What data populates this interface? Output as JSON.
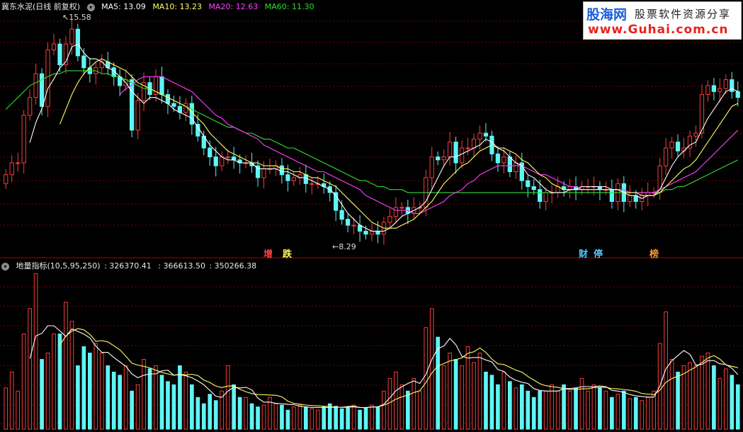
{
  "header": {
    "stock_name": "冀东水泥(日线 前复权)",
    "ma5": "MA5: 13.09",
    "ma10": "MA10: 13.23",
    "ma20": "MA20: 12.63",
    "ma60": "MA60: 11.30"
  },
  "indicator_header": {
    "name": "地量指标(10,5,95,250)",
    "v1": ": 326370.41",
    "v2": ": 366613.50",
    "v3": ": 350266.38"
  },
  "watermark": {
    "brand": "股海网",
    "slogan": "股票软件资源分享",
    "url": "www.Guhai.com.cn"
  },
  "events": [
    {
      "label": "增",
      "color": "#ff4040"
    },
    {
      "label": "跌",
      "color": "#ffff55"
    },
    {
      "label": "财",
      "color": "#55c8ff"
    },
    {
      "label": "停",
      "color": "#55c8ff"
    },
    {
      "label": "榜",
      "color": "#ff9a30"
    }
  ],
  "colors": {
    "up": "#ff3b3b",
    "down": "#5ff5f5",
    "ma5": "#ffffff",
    "ma10": "#ffff66",
    "ma20": "#ff40ff",
    "ma60": "#33dd33",
    "grid": "#7a0000",
    "separator": "#b00000"
  },
  "chart_data": [
    {
      "type": "candlestick",
      "title": "冀东水泥(日线 前复权)",
      "max_label": "15.58",
      "min_label": "8.29",
      "ylim": [
        7.8,
        16.0
      ],
      "series_names": [
        "MA5",
        "MA10",
        "MA20",
        "MA60"
      ],
      "close": [
        10.5,
        10.9,
        10.9,
        12.5,
        13.1,
        13.9,
        12.8,
        14.7,
        14.9,
        14.2,
        14.9,
        15.4,
        14.5,
        14.1,
        13.9,
        14.1,
        14.3,
        14.1,
        13.8,
        13.5,
        13.7,
        12.0,
        13.0,
        13.6,
        13.2,
        13.8,
        13.2,
        12.9,
        12.8,
        12.6,
        12.9,
        12.2,
        11.8,
        11.4,
        11.1,
        10.8,
        11.1,
        11.1,
        11.0,
        10.9,
        10.9,
        10.8,
        10.4,
        10.7,
        10.7,
        10.8,
        10.5,
        10.3,
        10.4,
        10.5,
        10.2,
        10.2,
        10.2,
        10.1,
        9.9,
        9.3,
        9.0,
        8.8,
        8.8,
        8.6,
        8.5,
        8.6,
        8.5,
        8.9,
        9.1,
        9.4,
        9.4,
        9.2,
        9.4,
        9.4,
        10.4,
        11.1,
        11.0,
        11.1,
        11.6,
        10.9,
        11.4,
        11.4,
        11.7,
        11.9,
        11.8,
        11.2,
        10.9,
        11.1,
        10.6,
        10.9,
        10.3,
        10.1,
        10.0,
        9.6,
        9.9,
        9.9,
        10.1,
        10.0,
        10.1,
        10.0,
        10.1,
        10.1,
        10.1,
        10.0,
        10.0,
        9.6,
        10.2,
        9.6,
        9.8,
        9.6,
        9.8,
        9.9,
        9.9,
        10.8,
        11.4,
        11.6,
        11.3,
        11.4,
        11.8,
        11.9,
        13.2,
        13.5,
        13.3,
        13.4,
        13.7,
        13.3,
        13.1
      ],
      "ma5": [
        null,
        null,
        null,
        null,
        11.58,
        12.26,
        12.72,
        13.4,
        13.72,
        14.1,
        14.3,
        14.8,
        14.9,
        14.6,
        14.4,
        14.4,
        14.3,
        14.1,
        14.0,
        13.8,
        13.6,
        13.3,
        13.1,
        12.9,
        13.1,
        13.1,
        13.0,
        12.9,
        12.7,
        12.6,
        12.5,
        12.4,
        12.1,
        11.8,
        11.5,
        11.3,
        11.1,
        11.0,
        11.0,
        10.9,
        10.9,
        10.9,
        10.7,
        10.7,
        10.7,
        10.7,
        10.6,
        10.6,
        10.5,
        10.4,
        10.4,
        10.3,
        10.2,
        10.1,
        10.0,
        9.8,
        9.5,
        9.2,
        9.0,
        8.8,
        8.7,
        8.6,
        8.6,
        8.6,
        8.7,
        8.9,
        9.1,
        9.2,
        9.3,
        9.4,
        9.6,
        10.0,
        10.4,
        10.8,
        11.1,
        11.1,
        11.2,
        11.3,
        11.4,
        11.5,
        11.7,
        11.6,
        11.4,
        11.3,
        11.1,
        10.9,
        10.8,
        10.5,
        10.4,
        10.2,
        10.0,
        9.9,
        9.9,
        9.9,
        10.0,
        10.0,
        10.1,
        10.1,
        10.1,
        10.1,
        10.1,
        10.0,
        10.0,
        9.9,
        9.8,
        9.8,
        9.7,
        9.8,
        9.8,
        10.0,
        10.4,
        10.8,
        11.1,
        11.3,
        11.5,
        11.6,
        12.0,
        12.4,
        12.7,
        13.0,
        13.3,
        13.4,
        13.3
      ],
      "ma10": [
        null,
        null,
        null,
        null,
        null,
        null,
        null,
        null,
        null,
        12.2,
        12.7,
        13.2,
        13.6,
        13.9,
        14.1,
        14.3,
        14.4,
        14.3,
        14.2,
        14.1,
        14.0,
        13.8,
        13.6,
        13.5,
        13.4,
        13.3,
        13.2,
        13.1,
        13.0,
        12.9,
        12.8,
        12.6,
        12.4,
        12.2,
        11.9,
        11.7,
        11.5,
        11.3,
        11.2,
        11.1,
        11.0,
        10.9,
        10.9,
        10.8,
        10.8,
        10.8,
        10.7,
        10.7,
        10.6,
        10.6,
        10.5,
        10.4,
        10.4,
        10.3,
        10.2,
        10.1,
        9.9,
        9.7,
        9.5,
        9.3,
        9.1,
        8.9,
        8.8,
        8.7,
        8.7,
        8.7,
        8.8,
        8.9,
        9.0,
        9.2,
        9.4,
        9.6,
        9.9,
        10.2,
        10.4,
        10.6,
        10.8,
        10.9,
        11.1,
        11.3,
        11.4,
        11.5,
        11.4,
        11.4,
        11.3,
        11.2,
        11.0,
        10.9,
        10.7,
        10.5,
        10.4,
        10.2,
        10.1,
        10.0,
        10.0,
        10.0,
        10.0,
        10.0,
        10.0,
        10.0,
        10.0,
        10.0,
        10.0,
        9.9,
        9.9,
        9.9,
        9.8,
        9.8,
        9.8,
        9.9,
        10.1,
        10.3,
        10.5,
        10.7,
        10.8,
        11.0,
        11.3,
        11.6,
        11.9,
        12.2,
        12.5,
        12.8,
        12.9
      ],
      "ma20": [
        null,
        null,
        null,
        null,
        null,
        null,
        null,
        null,
        null,
        null,
        null,
        null,
        null,
        null,
        null,
        null,
        null,
        null,
        null,
        13.2,
        13.4,
        13.5,
        13.7,
        13.8,
        13.8,
        13.8,
        13.8,
        13.7,
        13.6,
        13.5,
        13.4,
        13.3,
        13.1,
        12.9,
        12.7,
        12.5,
        12.4,
        12.2,
        12.1,
        12.0,
        11.9,
        11.8,
        11.7,
        11.5,
        11.4,
        11.3,
        11.2,
        11.1,
        11.0,
        10.9,
        10.8,
        10.7,
        10.6,
        10.6,
        10.5,
        10.4,
        10.3,
        10.2,
        10.1,
        10.0,
        9.8,
        9.7,
        9.6,
        9.5,
        9.4,
        9.3,
        9.3,
        9.3,
        9.2,
        9.2,
        9.3,
        9.4,
        9.5,
        9.6,
        9.8,
        9.9,
        10.0,
        10.2,
        10.3,
        10.5,
        10.6,
        10.7,
        10.8,
        10.8,
        10.8,
        10.8,
        10.8,
        10.7,
        10.6,
        10.5,
        10.5,
        10.4,
        10.3,
        10.2,
        10.1,
        10.1,
        10.0,
        10.0,
        10.0,
        10.0,
        10.0,
        10.0,
        10.0,
        10.0,
        9.9,
        9.9,
        9.9,
        9.9,
        9.9,
        10.0,
        10.1,
        10.2,
        10.3,
        10.4,
        10.5,
        10.6,
        10.8,
        11.0,
        11.2,
        11.4,
        11.6,
        11.8,
        12.0
      ],
      "ma60": [
        12.7,
        12.9,
        13.1,
        13.3,
        13.5,
        13.6,
        13.7,
        13.8,
        13.9,
        13.9,
        14.0,
        14.0,
        14.0,
        14.0,
        14.0,
        14.0,
        13.9,
        13.9,
        13.8,
        13.8,
        13.7,
        13.6,
        13.5,
        13.4,
        13.4,
        13.3,
        13.2,
        13.1,
        13.0,
        12.9,
        12.8,
        12.7,
        12.6,
        12.5,
        12.4,
        12.3,
        12.2,
        12.1,
        12.1,
        12.0,
        11.9,
        11.9,
        11.8,
        11.7,
        11.7,
        11.6,
        11.5,
        11.4,
        11.4,
        11.3,
        11.2,
        11.1,
        11.0,
        10.9,
        10.8,
        10.7,
        10.6,
        10.5,
        10.4,
        10.3,
        10.3,
        10.2,
        10.1,
        10.1,
        10.0,
        10.0,
        10.0,
        9.9,
        9.9,
        9.9,
        9.9,
        9.9,
        9.9,
        9.9,
        9.9,
        9.9,
        9.9,
        9.9,
        9.9,
        9.9,
        9.9,
        9.9,
        9.9,
        9.9,
        9.9,
        9.9,
        9.9,
        9.9,
        9.9,
        9.9,
        9.9,
        9.9,
        9.9,
        9.9,
        9.9,
        9.9,
        9.9,
        9.9,
        9.9,
        9.9,
        9.9,
        9.9,
        9.9,
        9.9,
        9.9,
        9.9,
        9.9,
        9.9,
        9.9,
        9.9,
        10.0,
        10.0,
        10.1,
        10.1,
        10.2,
        10.3,
        10.4,
        10.5,
        10.6,
        10.7,
        10.8,
        10.9,
        11.0
      ]
    },
    {
      "type": "bar",
      "title": "地量指标(10,5,95,250)",
      "ylim": [
        0,
        2500000
      ],
      "volume": [
        650000,
        900000,
        600000,
        1500000,
        1900000,
        2450000,
        1100000,
        1200000,
        1500000,
        1500000,
        2000000,
        1700000,
        1000000,
        1300000,
        1200000,
        1350000,
        1200000,
        1000000,
        900000,
        850000,
        1000000,
        600000,
        700000,
        1100000,
        950000,
        1000000,
        850000,
        750000,
        700000,
        1000000,
        900000,
        700000,
        500000,
        400000,
        550000,
        450000,
        600000,
        1000000,
        700000,
        500000,
        500000,
        400000,
        350000,
        380000,
        500000,
        400000,
        380000,
        300000,
        350000,
        380000,
        350000,
        320000,
        300000,
        350000,
        400000,
        360000,
        320000,
        350000,
        380000,
        300000,
        340000,
        380000,
        350000,
        600000,
        800000,
        900000,
        700000,
        600000,
        800000,
        600000,
        1600000,
        1900000,
        1450000,
        1000000,
        1200000,
        1100000,
        1000000,
        1300000,
        1050000,
        1200000,
        900000,
        850000,
        700000,
        900000,
        750000,
        650000,
        700000,
        600000,
        500000,
        600000,
        600000,
        700000,
        600000,
        700000,
        600000,
        650000,
        800000,
        600000,
        700000,
        650000,
        600000,
        500000,
        550000,
        600000,
        480000,
        500000,
        450000,
        500000,
        600000,
        1350000,
        1850000,
        1100000,
        900000,
        1000000,
        1050000,
        1000000,
        1150000,
        1200000,
        1000000,
        800000,
        950000,
        850000,
        700000
      ],
      "ma1_label": "MA10",
      "ma2_label": "MA5"
    }
  ]
}
